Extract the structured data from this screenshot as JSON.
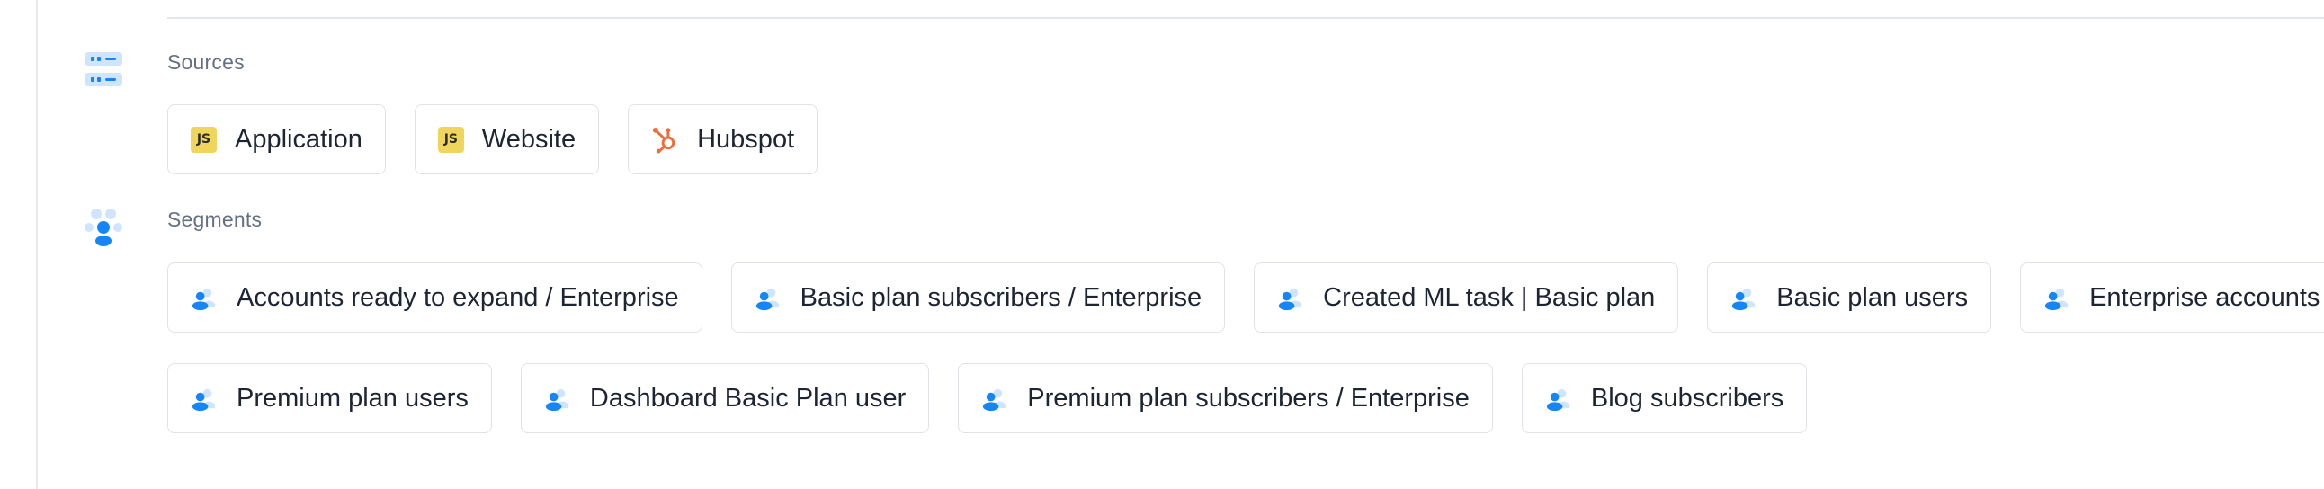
{
  "sections": {
    "sources": {
      "label": "Sources",
      "icon": "sources-list-icon",
      "items": [
        {
          "label": "Application",
          "icon": "javascript-icon",
          "badge": "JS"
        },
        {
          "label": "Website",
          "icon": "javascript-icon",
          "badge": "JS"
        },
        {
          "label": "Hubspot",
          "icon": "hubspot-icon"
        }
      ]
    },
    "segments": {
      "label": "Segments",
      "icon": "segments-group-icon",
      "rows": [
        [
          {
            "label": "Accounts ready to expand / Enterprise",
            "icon": "segment-users-icon"
          },
          {
            "label": "Basic plan subscribers / Enterprise",
            "icon": "segment-users-icon"
          },
          {
            "label": "Created ML task | Basic plan",
            "icon": "segment-users-icon"
          },
          {
            "label": "Basic plan users",
            "icon": "segment-users-icon"
          },
          {
            "label": "Enterprise accounts",
            "icon": "segment-users-icon"
          }
        ],
        [
          {
            "label": "Premium plan users",
            "icon": "segment-users-icon"
          },
          {
            "label": "Dashboard Basic Plan user",
            "icon": "segment-users-icon"
          },
          {
            "label": "Premium plan subscribers / Enterprise",
            "icon": "segment-users-icon"
          },
          {
            "label": "Blog subscribers",
            "icon": "segment-users-icon"
          }
        ]
      ]
    }
  },
  "colors": {
    "accent_blue": "#1685f6",
    "light_blue": "#cfe5ff",
    "js_yellow": "#f0d55c",
    "hubspot_orange": "#f26c3b",
    "border": "#dfe3e8",
    "label_gray": "#667085"
  }
}
